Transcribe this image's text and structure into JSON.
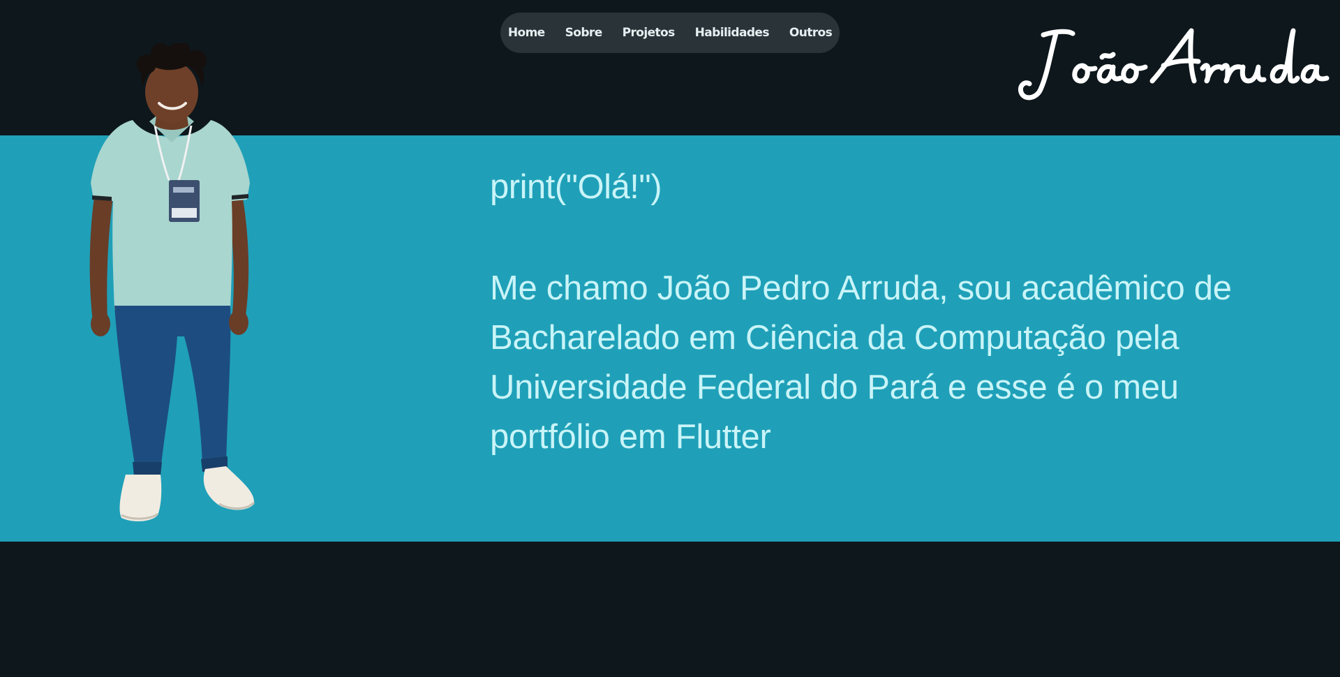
{
  "nav": {
    "items": [
      {
        "label": "Home"
      },
      {
        "label": "Sobre"
      },
      {
        "label": "Projetos"
      },
      {
        "label": "Habilidades"
      },
      {
        "label": "Outros"
      }
    ]
  },
  "header": {
    "signature_text": "João Arruda"
  },
  "hero": {
    "greeting": "print(\"Olá!\")",
    "intro": "Me chamo João Pedro Arruda, sou acadêmico de Bacharelado em Ciência da Computação pela Universidade Federal do Pará e esse é o meu portfólio em Flutter"
  },
  "colors": {
    "background": "#0d171c",
    "band": "#1fa0b8",
    "nav_pill": "#2a3337",
    "hero_text": "#c9f4f8"
  }
}
